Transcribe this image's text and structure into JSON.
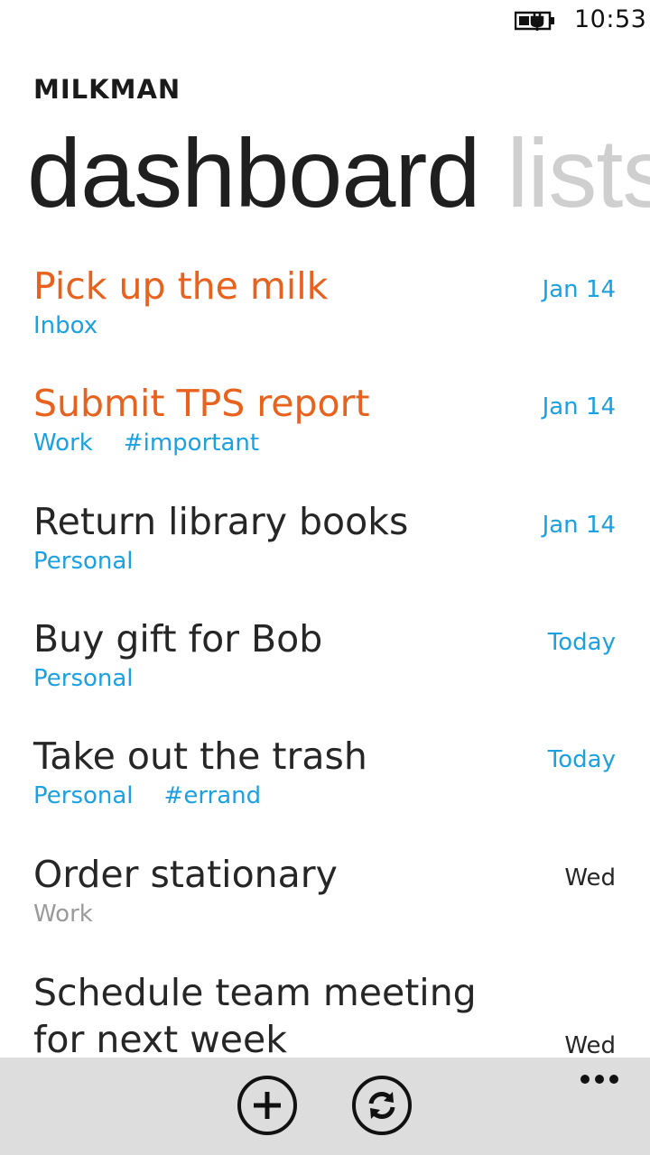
{
  "status": {
    "time": "10:53"
  },
  "app": {
    "name": "MILKMAN"
  },
  "pivot": {
    "active": "dashboard",
    "next": "lists"
  },
  "tasks": [
    {
      "title": "Pick up the milk",
      "date": "Jan 14",
      "tags": [
        "Inbox"
      ]
    },
    {
      "title": "Submit TPS report",
      "date": "Jan 14",
      "tags": [
        "Work",
        "#important"
      ]
    },
    {
      "title": "Return library books",
      "date": "Jan 14",
      "tags": [
        "Personal"
      ]
    },
    {
      "title": "Buy gift for Bob",
      "date": "Today",
      "tags": [
        "Personal"
      ]
    },
    {
      "title": "Take out the trash",
      "date": "Today",
      "tags": [
        "Personal",
        "#errand"
      ]
    },
    {
      "title": "Order stationary",
      "date": "Wed",
      "tags": [
        "Work"
      ]
    },
    {
      "title": "Schedule team meeting for next week",
      "date": "Wed",
      "tags": []
    }
  ],
  "appbar": {
    "buttons": [
      "add-icon",
      "sync-icon"
    ],
    "more": "..."
  },
  "colors": {
    "accent": "#1ba1e2",
    "overdue": "#e8621e",
    "muted": "#9a9a9a",
    "appbar": "#dddddd"
  }
}
